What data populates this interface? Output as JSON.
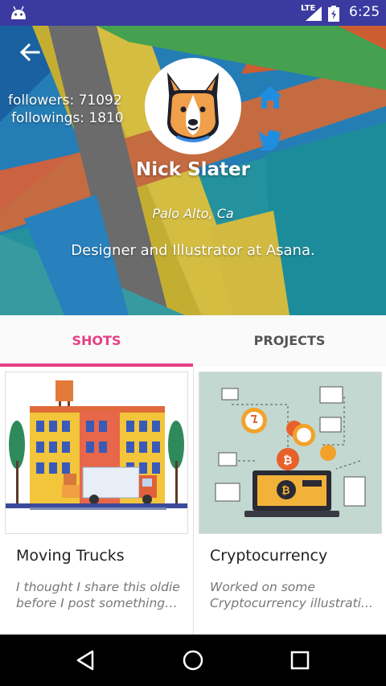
{
  "status_bar": {
    "network": "LTE",
    "time": "6:25"
  },
  "profile": {
    "followers_text": "followers: 71092",
    "followings_text": "followings: 1810",
    "name": "Nick Slater",
    "location": "Palo Alto, Ca",
    "bio": "Designer and Illustrator at Asana."
  },
  "icons": {
    "back": "arrow-back-icon",
    "home": "home-icon",
    "twitter": "twitter-icon",
    "avatar": "corgi-dog-avatar"
  },
  "tabs": [
    {
      "label": "SHOTS",
      "selected": true
    },
    {
      "label": "PROJECTS",
      "selected": false
    }
  ],
  "cards": [
    {
      "title": "Moving Trucks",
      "desc_line1": "I thought I share this oldie",
      "desc_line2": "before I post something...."
    },
    {
      "title": "Cryptocurrency",
      "desc_line1": "Worked on some",
      "desc_line2": "Cryptocurrency illustrati..."
    }
  ],
  "colors": {
    "status_bar": "#3a3aa0",
    "accent": "#e63f86",
    "social_icon": "#1f8ee0"
  }
}
